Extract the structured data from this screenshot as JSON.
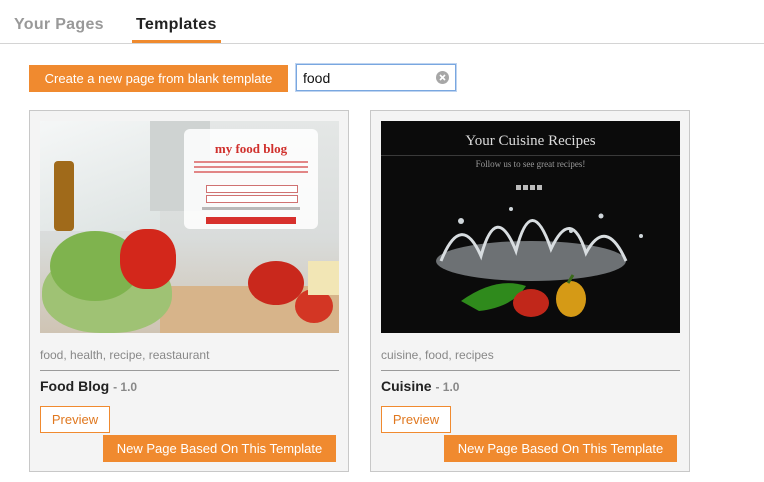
{
  "tabs": [
    {
      "label": "Your Pages",
      "active": false
    },
    {
      "label": "Templates",
      "active": true
    }
  ],
  "toolbar": {
    "create_label": "Create a new page from blank template",
    "search_value": "food"
  },
  "templates": [
    {
      "tags": "food, health, recipe, reastaurant",
      "name": "Food Blog",
      "version": "- 1.0",
      "preview_label": "Preview",
      "new_page_label": "New Page Based On This Template",
      "thumbnail": {
        "heading": "my food blog"
      }
    },
    {
      "tags": "cuisine, food, recipes",
      "name": "Cuisine",
      "version": "- 1.0",
      "preview_label": "Preview",
      "new_page_label": "New Page Based On This Template",
      "thumbnail": {
        "heading": "Your Cuisine Recipes",
        "subheading": "Follow us to see great recipes!"
      }
    }
  ],
  "colors": {
    "accent": "#f08a2f",
    "focus_border": "#79a7e0"
  }
}
